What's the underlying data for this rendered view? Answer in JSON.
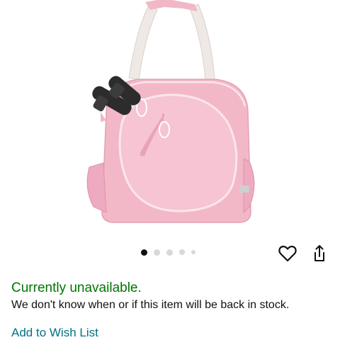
{
  "product": {
    "image_alt": "pink tennis bag",
    "image_count": 5,
    "active_image_index": 0
  },
  "actions": {
    "wishlist_icon": "heart-icon",
    "share_icon": "share-icon"
  },
  "availability": {
    "status": "Currently unavailable.",
    "message": "We don't know when or if this item will be back in stock.",
    "status_color": "#007600"
  },
  "wishlist": {
    "label": "Add to Wish List",
    "link_color": "#007185"
  }
}
